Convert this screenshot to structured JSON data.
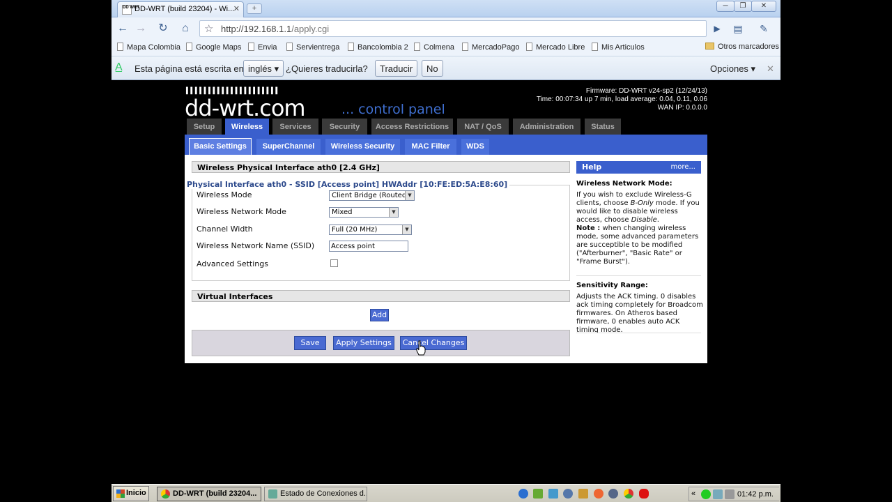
{
  "window": {
    "tab_title": "DD-WRT (build 23204) - Wi...",
    "favicon_text": "DD WRT"
  },
  "toolbar": {
    "url_host": "http://192.168.1.1",
    "url_path": "/apply.cgi"
  },
  "bookmarks": {
    "items": [
      "Mapa Colombia",
      "Google Maps",
      "Envia",
      "Servientrega",
      "Bancolombia 2",
      "Colmena",
      "MercadoPago",
      "Mercado Libre",
      "Mis Articulos"
    ],
    "other": "Otros marcadores"
  },
  "translate_bar": {
    "prefix": "Esta página está escrita en",
    "language": "inglés",
    "question": "¿Quieres traducirla?",
    "translate_button": "Traducir",
    "no_button": "No",
    "options": "Opciones"
  },
  "router": {
    "logo_text": "dd-wrt.com",
    "logo_dots": "▌▌▌▌▌▌▌▌▌▌▌▌▌▌▌▌▌▌▌▌▌",
    "control_panel": "... control panel",
    "firmware": "Firmware: DD-WRT v24-sp2 (12/24/13)",
    "time": "Time: 00:07:34 up 7 min, load average: 0.04, 0.11, 0.06",
    "wan_ip": "WAN IP: 0.0.0.0",
    "main_tabs": [
      "Setup",
      "Wireless",
      "Services",
      "Security",
      "Access Restrictions",
      "NAT / QoS",
      "Administration",
      "Status"
    ],
    "active_main_tab": "Wireless",
    "sub_tabs": [
      "Basic Settings",
      "SuperChannel",
      "Wireless Security",
      "MAC Filter",
      "WDS"
    ],
    "active_sub_tab": "Basic Settings"
  },
  "form": {
    "section_title": "Wireless Physical Interface ath0 [2.4 GHz]",
    "interface_legend": "Physical Interface ath0 - SSID [Access point] HWAddr [10:FE:ED:5A:E8:60]",
    "wireless_mode_label": "Wireless Mode",
    "wireless_mode_value": "Client Bridge (Routed)",
    "network_mode_label": "Wireless Network Mode",
    "network_mode_value": "Mixed",
    "channel_width_label": "Channel Width",
    "channel_width_value": "Full (20 MHz)",
    "ssid_label": "Wireless Network Name (SSID)",
    "ssid_value": "Access point",
    "advanced_label": "Advanced Settings",
    "advanced_checked": false,
    "virtual_title": "Virtual Interfaces",
    "add_button": "Add",
    "save_button": "Save",
    "apply_button": "Apply Settings",
    "cancel_button": "Cancel Changes"
  },
  "help": {
    "title": "Help",
    "more": "more...",
    "mode_title": "Wireless Network Mode:",
    "mode_text_1": "If you wish to exclude Wireless-G clients, choose",
    "mode_text_b_only": "B-Only",
    "mode_text_2": "mode. If you would like to disable wireless access, choose",
    "mode_text_disable": "Disable",
    "mode_note_label": "Note :",
    "mode_note_text": "when changing wireless mode, some advanced parameters are succeptible to be modified (\"Afterburner\", \"Basic Rate\" or \"Frame Burst\").",
    "sens_title": "Sensitivity Range:",
    "sens_text": "Adjusts the ACK timing. 0 disables ack timing completely for Broadcom firmwares. On Atheros based firmware, 0 enables auto ACK timing mode."
  },
  "taskbar": {
    "start": "Inicio",
    "tasks": [
      "DD-WRT (build 23204...",
      "Estado de Conexiones d..."
    ],
    "tray_chevron": "«",
    "clock": "01:42 p.m."
  }
}
